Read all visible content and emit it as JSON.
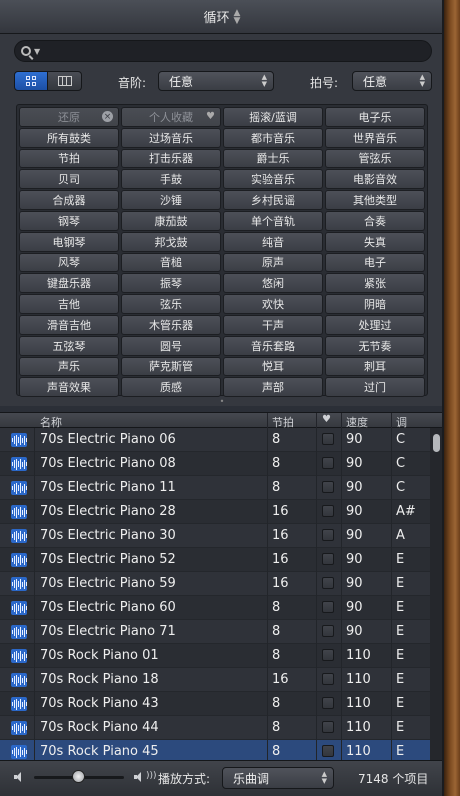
{
  "title": "循环",
  "search": {
    "placeholder": ""
  },
  "scale": {
    "label": "音阶:",
    "value": "任意"
  },
  "signature": {
    "label": "拍号:",
    "value": "任意"
  },
  "keywords": [
    "还原",
    "个人收藏",
    "摇滚/蓝调",
    "电子乐",
    "所有鼓类",
    "过场音乐",
    "都市音乐",
    "世界音乐",
    "节拍",
    "打击乐器",
    "爵士乐",
    "管弦乐",
    "贝司",
    "手鼓",
    "实验音乐",
    "电影音效",
    "合成器",
    "沙锤",
    "乡村民谣",
    "其他类型",
    "钢琴",
    "康茄鼓",
    "单个音轨",
    "合奏",
    "电钢琴",
    "邦戈鼓",
    "纯音",
    "失真",
    "风琴",
    "音槌",
    "原声",
    "电子",
    "键盘乐器",
    "振琴",
    "悠闲",
    "紧张",
    "吉他",
    "弦乐",
    "欢快",
    "阴暗",
    "滑音吉他",
    "木管乐器",
    "干声",
    "处理过",
    "五弦琴",
    "圆号",
    "音乐套路",
    "无节奏",
    "声乐",
    "萨克斯管",
    "悦耳",
    "刺耳",
    "声音效果",
    "质感",
    "声部",
    "过门"
  ],
  "columns": {
    "name": "名称",
    "beats": "节拍",
    "tempo": "速度",
    "key": "调"
  },
  "rows": [
    {
      "name": "70s Electric Piano 06",
      "beats": "8",
      "tempo": "90",
      "key": "C"
    },
    {
      "name": "70s Electric Piano 08",
      "beats": "8",
      "tempo": "90",
      "key": "C"
    },
    {
      "name": "70s Electric Piano 11",
      "beats": "8",
      "tempo": "90",
      "key": "C"
    },
    {
      "name": "70s Electric Piano 28",
      "beats": "16",
      "tempo": "90",
      "key": "A#"
    },
    {
      "name": "70s Electric Piano 30",
      "beats": "16",
      "tempo": "90",
      "key": "A"
    },
    {
      "name": "70s Electric Piano 52",
      "beats": "16",
      "tempo": "90",
      "key": "E"
    },
    {
      "name": "70s Electric Piano 59",
      "beats": "16",
      "tempo": "90",
      "key": "E"
    },
    {
      "name": "70s Electric Piano 60",
      "beats": "8",
      "tempo": "90",
      "key": "E"
    },
    {
      "name": "70s Electric Piano 71",
      "beats": "8",
      "tempo": "90",
      "key": "E"
    },
    {
      "name": "70s Rock Piano 01",
      "beats": "8",
      "tempo": "110",
      "key": "E"
    },
    {
      "name": "70s Rock Piano 18",
      "beats": "16",
      "tempo": "110",
      "key": "E"
    },
    {
      "name": "70s Rock Piano 43",
      "beats": "8",
      "tempo": "110",
      "key": "E"
    },
    {
      "name": "70s Rock Piano 44",
      "beats": "8",
      "tempo": "110",
      "key": "E"
    },
    {
      "name": "70s Rock Piano 45",
      "beats": "8",
      "tempo": "110",
      "key": "E"
    }
  ],
  "footer": {
    "play_label": "播放方式:",
    "play_value": "乐曲调",
    "count": "7148 个项目"
  },
  "icons": {
    "search": "search-icon",
    "waveform": "audio-loop-icon",
    "heart": "heart-icon",
    "clear": "close-circle-icon"
  }
}
